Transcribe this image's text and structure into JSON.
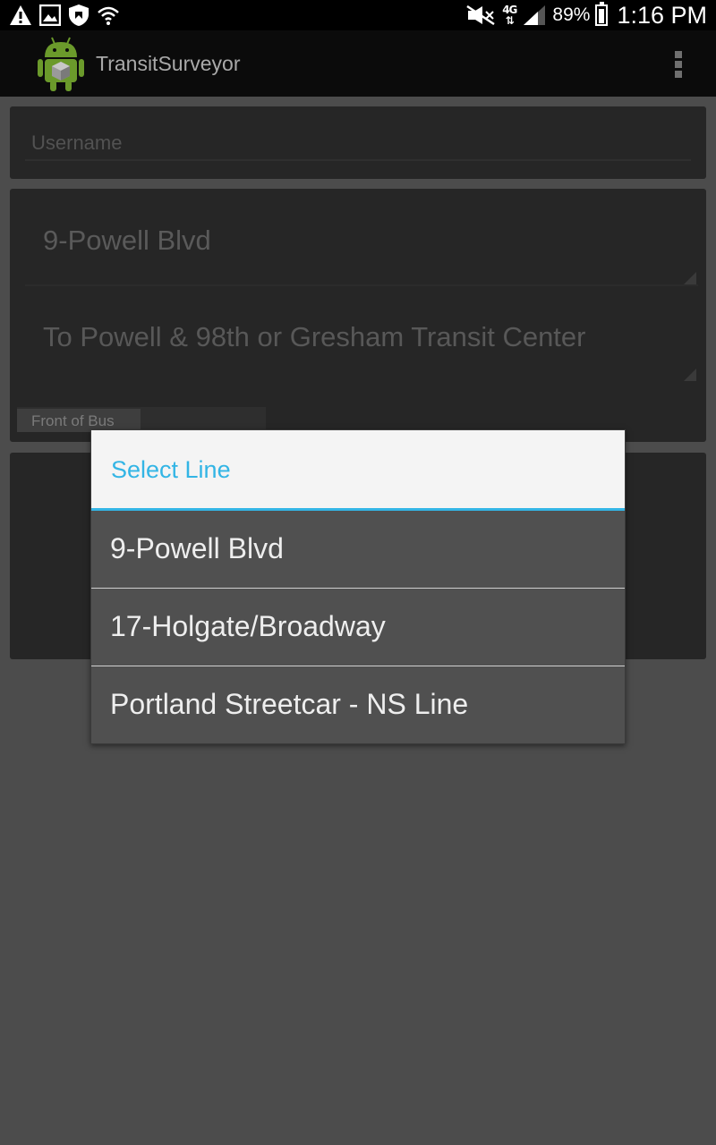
{
  "status_bar": {
    "icons_left": [
      "warning-icon",
      "image-icon",
      "shield-icon",
      "wifi-question-icon"
    ],
    "icons_right": [
      "mute-icon",
      "lte-icon",
      "signal-icon",
      "battery-icon"
    ],
    "network_label": "4G",
    "battery_percent": "89%",
    "time": "1:16 PM"
  },
  "action_bar": {
    "app_title": "TransitSurveyor",
    "app_icon": "android-robot-icon",
    "overflow_icon": "overflow-menu-icon"
  },
  "form": {
    "username_placeholder": "Username",
    "line": "9-Powell Blvd",
    "destination": "To Powell & 98th or Gresham Transit Center",
    "front_of_bus": "Front of Bus"
  },
  "dialog": {
    "title": "Select Line",
    "options": [
      {
        "label": "9-Powell Blvd"
      },
      {
        "label": "17-Holgate/Broadway"
      },
      {
        "label": "Portland Streetcar - NS Line"
      }
    ]
  },
  "colors": {
    "accent": "#33b5e5",
    "background": "#4c4c4c",
    "dialog_item_bg": "#505050"
  }
}
